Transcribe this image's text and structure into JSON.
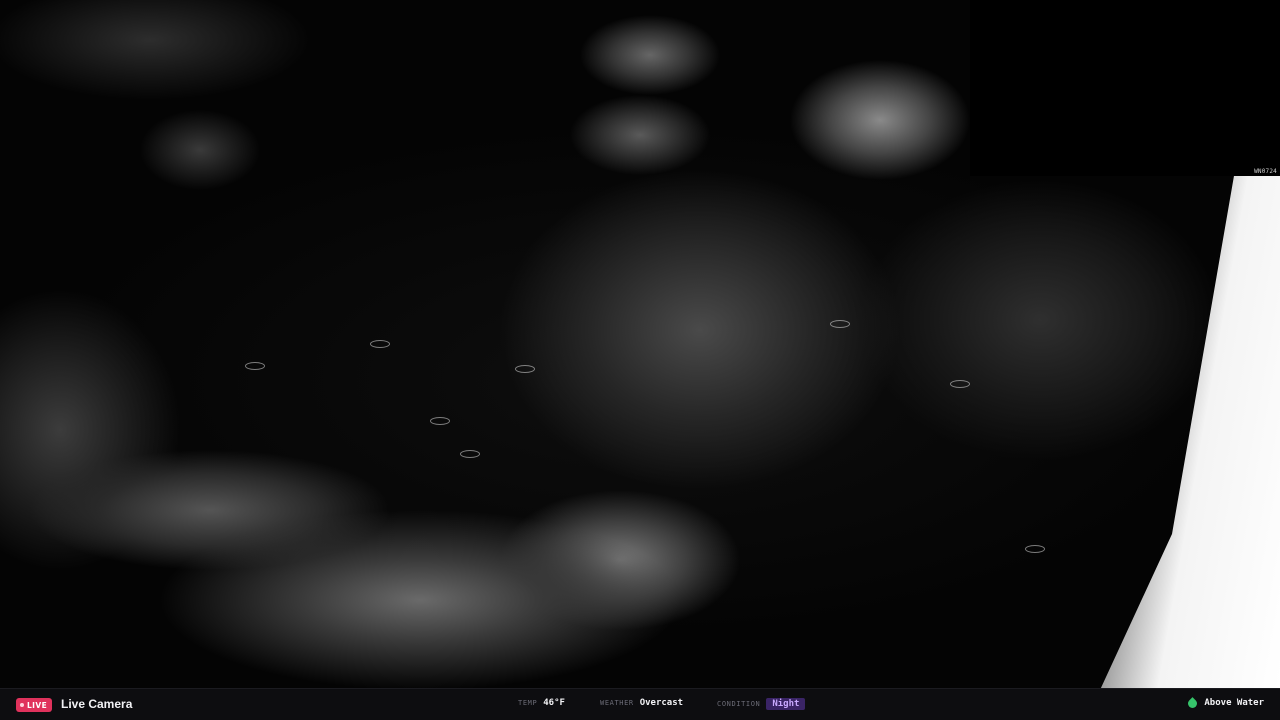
{
  "camera": {
    "pip_label": "WN0724"
  },
  "statusbar": {
    "live_label": "LIVE",
    "title": "Live Camera",
    "temp": {
      "label": "TEMP",
      "value": "46°F"
    },
    "weather": {
      "label": "WEATHER",
      "value": "Overcast"
    },
    "condition": {
      "label": "CONDITION",
      "value": "Night"
    },
    "water_status": "Above Water"
  },
  "colors": {
    "live_badge": "#e0325c",
    "condition_pill_bg": "#3a2466",
    "condition_pill_text": "#c9a9ff",
    "water_icon": "#36c46b",
    "bar_bg": "#0d0d10"
  },
  "icons": {
    "live": "live-dot-icon",
    "water": "water-drop-icon"
  }
}
